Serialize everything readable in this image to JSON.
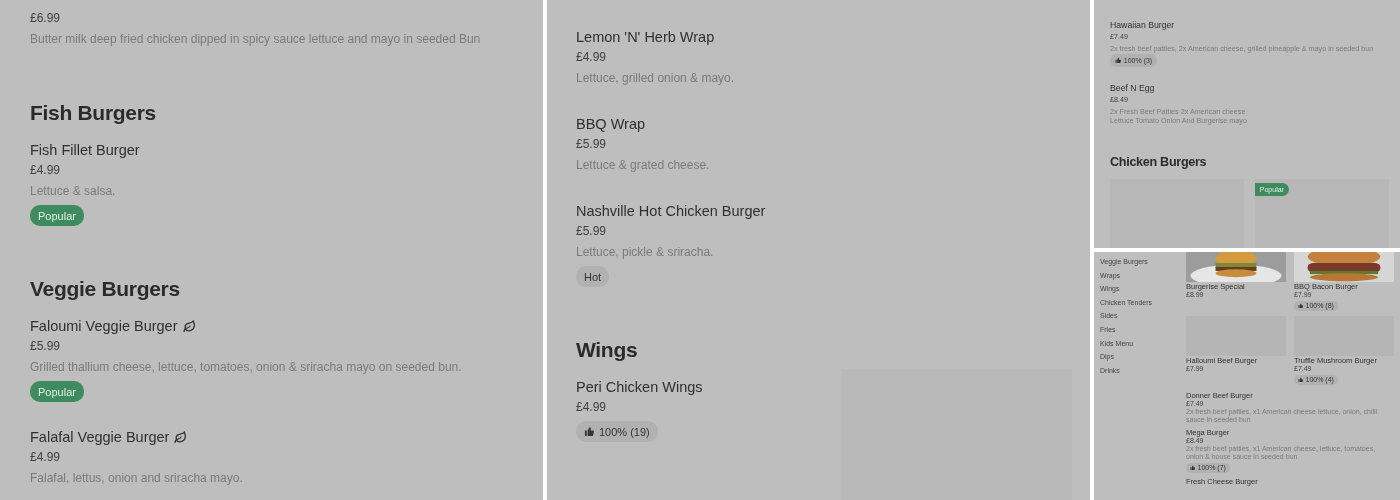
{
  "panels": [
    {
      "kind": "large",
      "blocks": [
        {
          "kind": "item",
          "price": "£6.99",
          "description": "Butter milk deep fried chicken dipped in spicy sauce lettuce and mayo in seeded Bun"
        },
        {
          "kind": "heading",
          "title": "Fish Burgers"
        },
        {
          "kind": "item",
          "name": "Fish Fillet Burger",
          "price": "£4.99",
          "description": "Lettuce & salsa.",
          "tags": [
            {
              "kind": "popular",
              "label": "Popular"
            }
          ]
        },
        {
          "kind": "heading",
          "title": "Veggie Burgers"
        },
        {
          "kind": "item",
          "name": "Faloumi Veggie Burger",
          "vegetarian": true,
          "price": "£5.99",
          "description": "Grilled thallium cheese, lettuce, tomatoes, onion & sriracha mayo on seeded bun.",
          "tags": [
            {
              "kind": "popular",
              "label": "Popular"
            }
          ]
        },
        {
          "kind": "item",
          "name": "Falafal Veggie Burger",
          "vegetarian": true,
          "price": "£4.99",
          "description": "Falafal, lettus, onion and sriracha mayo."
        }
      ]
    },
    {
      "kind": "large",
      "blocks": [
        {
          "kind": "item",
          "name": "Lemon 'N' Herb Wrap",
          "price": "£4.99",
          "description": "Lettuce, grilled onion & mayo."
        },
        {
          "kind": "item",
          "name": "BBQ Wrap",
          "price": "£5.99",
          "description": "Lettuce & grated cheese."
        },
        {
          "kind": "item",
          "name": "Nashville Hot Chicken Burger",
          "price": "£5.99",
          "description": "Lettuce, pickle & sriracha.",
          "tags": [
            {
              "kind": "plain",
              "label": "Hot"
            }
          ]
        },
        {
          "kind": "heading",
          "title": "Wings"
        },
        {
          "kind": "item",
          "name": "Peri Chicken Wings",
          "price": "£4.99",
          "image": true,
          "tags": [
            {
              "kind": "rating",
              "label": "100% (19)"
            }
          ]
        }
      ]
    },
    {
      "kind": "small",
      "blocks": [
        {
          "kind": "item",
          "name": "Hawaiian Burger",
          "price": "£7.49",
          "description": "2x fresh beef patties, 2x American cheese, grilled pineapple & mayo in seeded bun",
          "tags": [
            {
              "kind": "rating",
              "label": "100% (3)"
            }
          ]
        },
        {
          "kind": "item",
          "name": "Beef N Egg",
          "price": "£8.49",
          "description": "2x Fresh Beef Patties 2x American cheese\nLettuce Tomato Onion And Burgerise mayo"
        },
        {
          "kind": "heading",
          "title": "Chicken Burgers"
        },
        {
          "kind": "cards",
          "cards": [
            {
              "kind": "placeholder"
            },
            {
              "kind": "placeholder",
              "tags": [
                {
                  "kind": "popular",
                  "label": "Popular"
                }
              ]
            }
          ]
        }
      ]
    },
    {
      "kind": "catalog",
      "categories": [
        "Veggie Burgers",
        "Wraps",
        "Wings",
        "Chicken Tenders",
        "Sides",
        "Fries",
        "Kids Menu",
        "Dips",
        "Drinks"
      ],
      "cards": [
        {
          "kind": "picture",
          "name": "Burgerise Special",
          "price": "£8.99"
        },
        {
          "kind": "picture",
          "name": "BBQ Bacon Burger",
          "price": "£7.99",
          "tags": [
            {
              "kind": "rating",
              "label": "100% (8)"
            }
          ]
        },
        {
          "kind": "placeholder",
          "name": "Halloumi Beef Burger",
          "price": "£7.99"
        },
        {
          "kind": "placeholder",
          "name": "Truffle Mushroom Burger",
          "price": "£7.49",
          "tags": [
            {
              "kind": "rating",
              "label": "100% (4)"
            }
          ]
        }
      ],
      "blocks": [
        {
          "kind": "item",
          "name": "Donner Beef Burger",
          "price": "£7.49",
          "description": "2x fresh beef patties, x1 American cheese lettuce, onion, chilli sauce in seeded bun"
        },
        {
          "kind": "item",
          "name": "Mega Burger",
          "price": "£8.49",
          "description": "2x fresh beef patties, x1 American cheese, lettuce, tomatoes, onion & house sauce in seeded bun",
          "tags": [
            {
              "kind": "rating",
              "label": "100% (7)"
            }
          ]
        },
        {
          "kind": "item",
          "name": "Fresh Cheese Burger"
        }
      ]
    }
  ]
}
